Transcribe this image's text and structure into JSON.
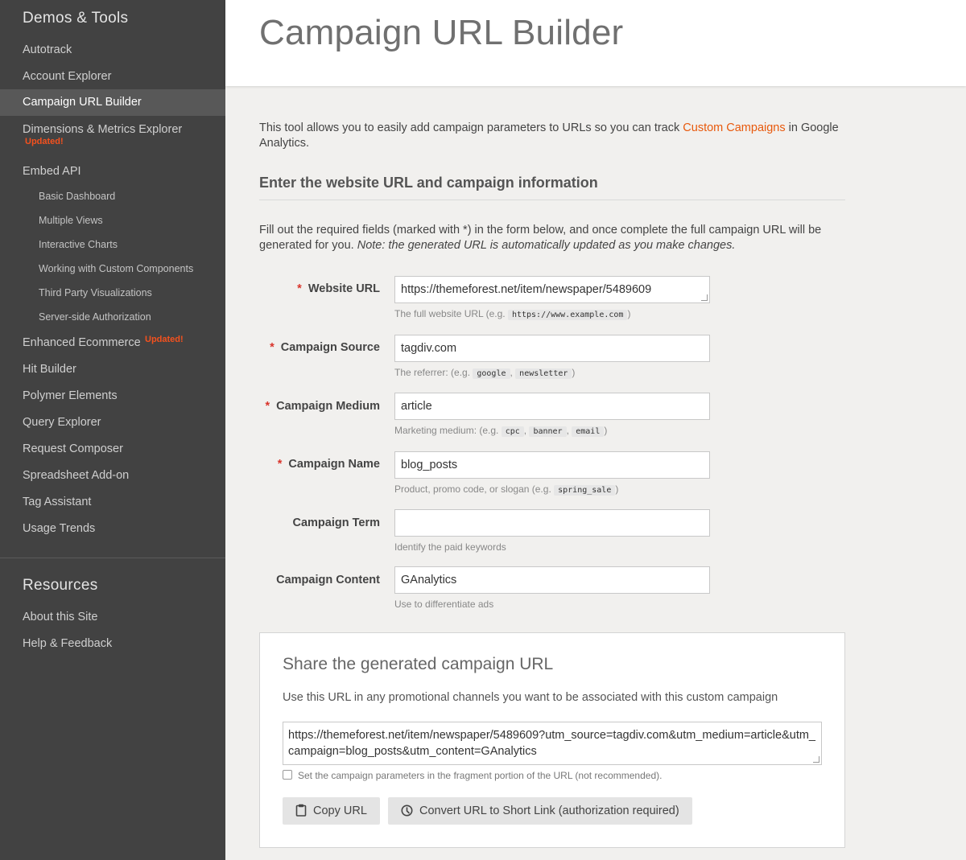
{
  "sidebar": {
    "heading": "Demos & Tools",
    "items": [
      {
        "label": "Autotrack"
      },
      {
        "label": "Account Explorer"
      },
      {
        "label": "Campaign URL Builder"
      },
      {
        "label": "Dimensions & Metrics Explorer",
        "badge": "Updated!"
      },
      {
        "label": "Embed API"
      }
    ],
    "subitems": [
      {
        "label": "Basic Dashboard"
      },
      {
        "label": "Multiple Views"
      },
      {
        "label": "Interactive Charts"
      },
      {
        "label": "Working with Custom Components"
      },
      {
        "label": "Third Party Visualizations"
      },
      {
        "label": "Server-side Authorization"
      }
    ],
    "items2": [
      {
        "label": "Enhanced Ecommerce",
        "badge": "Updated!"
      },
      {
        "label": "Hit Builder"
      },
      {
        "label": "Polymer Elements"
      },
      {
        "label": "Query Explorer"
      },
      {
        "label": "Request Composer"
      },
      {
        "label": "Spreadsheet Add-on"
      },
      {
        "label": "Tag Assistant"
      },
      {
        "label": "Usage Trends"
      }
    ],
    "resources_heading": "Resources",
    "resources": [
      {
        "label": "About this Site"
      },
      {
        "label": "Help & Feedback"
      }
    ],
    "active_color": "#585858",
    "badge_color": "#f4511e"
  },
  "header": {
    "title": "Campaign URL Builder"
  },
  "intro": {
    "before": "This tool allows you to easily add campaign parameters to URLs so you can track ",
    "link": "Custom Campaigns",
    "after": " in Google Analytics."
  },
  "section": {
    "heading": "Enter the website URL and campaign information",
    "instructions": "Fill out the required fields (marked with *) in the form below, and once complete the full campaign URL will be generated for you. ",
    "note": "Note: the generated URL is automatically updated as you make changes."
  },
  "form": {
    "required_mark": "*",
    "website_url": {
      "label": "Website URL",
      "value": "https://themeforest.net/item/newspaper/5489609",
      "help": "The full website URL (e.g. ",
      "examples": [
        "https://www.example.com"
      ],
      "help_end": ")"
    },
    "source": {
      "label": "Campaign Source",
      "value": "tagdiv.com",
      "help": "The referrer: (e.g. ",
      "examples": [
        "google",
        "newsletter"
      ],
      "help_end": ")"
    },
    "medium": {
      "label": "Campaign Medium",
      "value": "article",
      "help": "Marketing medium: (e.g. ",
      "examples": [
        "cpc",
        "banner",
        "email"
      ],
      "help_end": ")"
    },
    "name": {
      "label": "Campaign Name",
      "value": "blog_posts",
      "help": "Product, promo code, or slogan (e.g. ",
      "examples": [
        "spring_sale"
      ],
      "help_end": ")"
    },
    "term": {
      "label": "Campaign Term",
      "value": "",
      "help": "Identify the paid keywords"
    },
    "content": {
      "label": "Campaign Content",
      "value": "GAnalytics",
      "help": "Use to differentiate ads"
    },
    "separator": ", "
  },
  "share": {
    "title": "Share the generated campaign URL",
    "description": "Use this URL in any promotional channels you want to be associated with this custom campaign",
    "url": "https://themeforest.net/item/newspaper/5489609?utm_source=tagdiv.com&utm_medium=article&utm_campaign=blog_posts&utm_content=GAnalytics",
    "fragment_label": "Set the campaign parameters in the fragment portion of the URL (not recommended).",
    "copy_button": "Copy URL",
    "short_link_button": "Convert URL to Short Link (authorization required)"
  },
  "colors": {
    "link": "#e8590c",
    "required": "#d9342b",
    "sidebar_bg": "#424242"
  }
}
